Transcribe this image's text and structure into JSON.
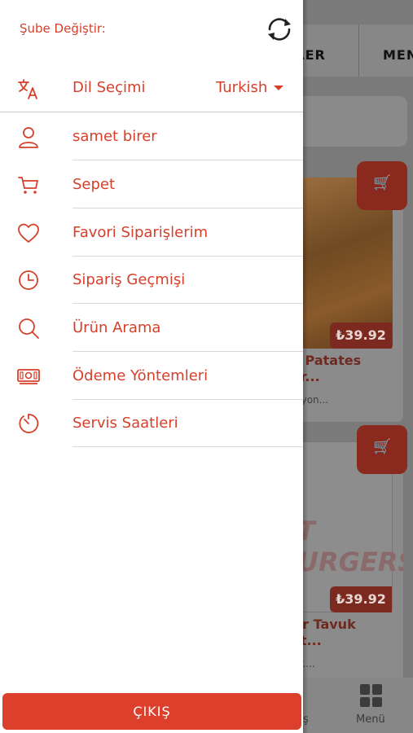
{
  "background_app": {
    "tabs": [
      "KLER",
      "MEN"
    ],
    "cards": [
      {
        "price": "₺39.92",
        "title": "lı Patates\nar...",
        "desc": "siyon..."
      },
      {
        "price": "₺39.92",
        "title": "tır Tavuk\net...",
        "desc": "gr....",
        "image_text": "T URGERS"
      }
    ],
    "bottom_nav": {
      "partial_label": "ş",
      "menu_label": "Menü"
    }
  },
  "drawer": {
    "branch_label": "Şube Değiştir:",
    "language": {
      "label": "Dil Seçimi",
      "value": "Turkish"
    },
    "items": [
      {
        "label": "samet birer",
        "icon": "user-icon"
      },
      {
        "label": "Sepet",
        "icon": "cart-icon"
      },
      {
        "label": "Favori Siparişlerim",
        "icon": "heart-icon"
      },
      {
        "label": "Sipariş Geçmişi",
        "icon": "clock-icon"
      },
      {
        "label": "Ürün Arama",
        "icon": "search-icon"
      },
      {
        "label": "Ödeme Yöntemleri",
        "icon": "money-icon"
      },
      {
        "label": "Servis Saatleri",
        "icon": "timer-icon"
      }
    ],
    "logout_label": "ÇIKIŞ"
  },
  "colors": {
    "accent": "#d6402b",
    "button": "#dc3f2b",
    "overlay": "#7a7a7a"
  }
}
